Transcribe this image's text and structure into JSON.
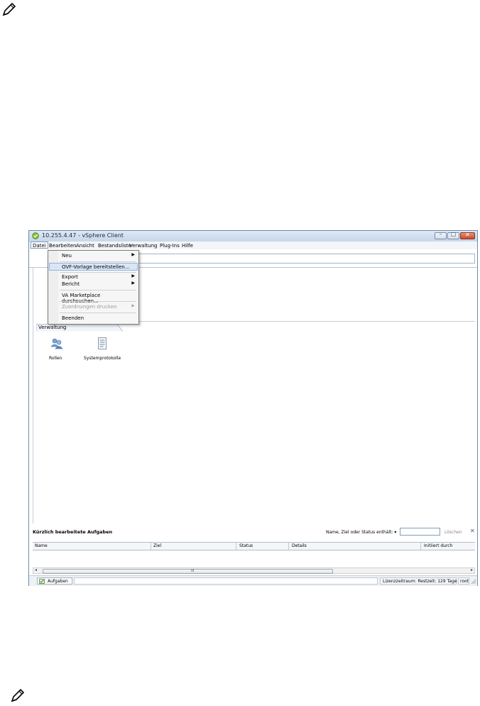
{
  "window": {
    "title": "10.255.4.47 - vSphere Client",
    "minimize_glyph": "–",
    "maximize_glyph": "□",
    "close_glyph": "✕"
  },
  "menubar": {
    "items": [
      "Datei",
      "Bearbeiten",
      "Ansicht",
      "Bestandsliste",
      "Verwaltung",
      "Plug-Ins",
      "Hilfe"
    ],
    "active": "Datei"
  },
  "file_menu": {
    "items": [
      {
        "label": "Neu",
        "submenu": true,
        "state": "normal"
      },
      {
        "label": "OVF-Vorlage bereitstellen...",
        "submenu": false,
        "state": "highlighted"
      },
      {
        "label": "Export",
        "submenu": true,
        "state": "normal"
      },
      {
        "label": "Bericht",
        "submenu": true,
        "state": "normal"
      },
      {
        "label": "VA Marketplace durchsuchen...",
        "submenu": false,
        "state": "normal"
      },
      {
        "label": "Zuordnungen drucken",
        "submenu": true,
        "state": "disabled"
      },
      {
        "label": "Beenden",
        "submenu": false,
        "state": "normal"
      }
    ],
    "submenu_arrow": "▶"
  },
  "section": {
    "title": "Verwaltung",
    "tiles": [
      {
        "label": "Rollen",
        "icon": "roles-users-icon"
      },
      {
        "label": "Systemprotokolle",
        "icon": "system-logs-document-icon"
      }
    ]
  },
  "tasks_panel": {
    "title": "Kürzlich bearbeitete Aufgaben",
    "filter_label": "Name, Ziel oder Status enthält: ▾",
    "filter_value": "",
    "clear_label": "Löschen",
    "close_glyph": "✕",
    "columns": [
      "Name",
      "Ziel",
      "Status",
      "Details",
      "Initiiert durch"
    ]
  },
  "scrollbar": {
    "left_arrow": "◂",
    "right_arrow": "▸",
    "grip": "III"
  },
  "statusbar": {
    "tasks_button": "Aufgaben",
    "license": "Lizenzzeitraum: Restzeit: 129 Tage",
    "user": "root"
  },
  "colors": {
    "title_gradient_top": "#dfe9f5",
    "menu_highlight": "#dbe6f4",
    "close_button": "#c44a2e"
  }
}
